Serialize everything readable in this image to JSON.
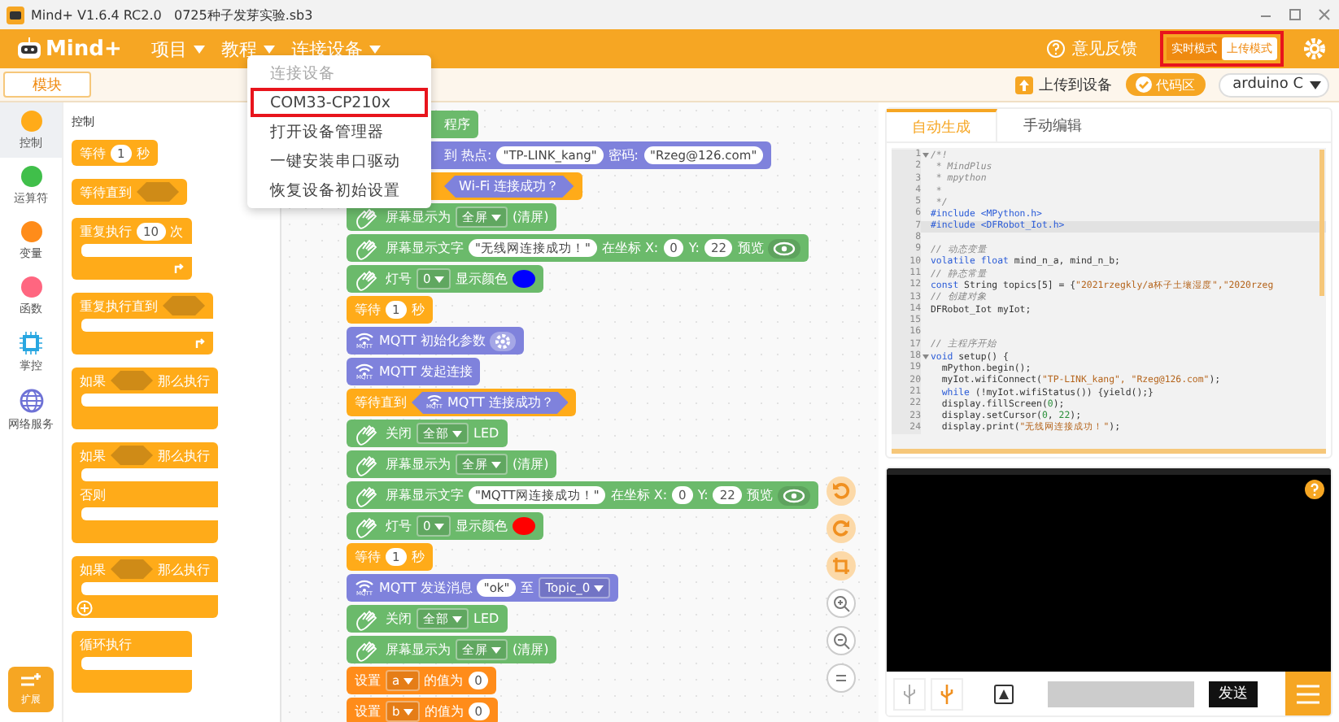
{
  "window": {
    "title": "Mind+ V1.6.4 RC2.0   0725种子发芽实验.sb3"
  },
  "menu_bar": {
    "logo": "Mind+",
    "menus": [
      {
        "label": "项目"
      },
      {
        "label": "教程"
      },
      {
        "label": "连接设备"
      }
    ],
    "feedback": "意见反馈",
    "modes": [
      {
        "label": "实时模式",
        "selected": false
      },
      {
        "label": "上传模式",
        "selected": true
      }
    ],
    "modes_highlighted": true
  },
  "connect_menu": {
    "items": [
      {
        "label": "连接设备",
        "disabled": true,
        "highlighted": false
      },
      {
        "label": "COM33-CP210x",
        "disabled": false,
        "highlighted": true
      },
      {
        "label": "打开设备管理器",
        "disabled": false,
        "highlighted": false
      },
      {
        "label": "一键安装串口驱动",
        "disabled": false,
        "highlighted": false
      },
      {
        "label": "恢复设备初始设置",
        "disabled": false,
        "highlighted": false
      }
    ]
  },
  "toolbar": {
    "blocks_tab": "模块",
    "upload": "上传到设备",
    "code_toggle": {
      "label": "代码区",
      "on": true
    },
    "device": "arduino C"
  },
  "categories": [
    {
      "label": "控制",
      "kind": "dot",
      "color": "#ffab19",
      "selected": true
    },
    {
      "label": "运算符",
      "kind": "dot",
      "color": "#40bf4a",
      "selected": false
    },
    {
      "label": "变量",
      "kind": "dot",
      "color": "#ff8c1a",
      "selected": false
    },
    {
      "label": "函数",
      "kind": "dot",
      "color": "#ff6680",
      "selected": false
    },
    {
      "label": "掌控",
      "kind": "chip",
      "color": "#29a7e1",
      "selected": false
    },
    {
      "label": "网络服务",
      "kind": "globe",
      "color": "#6e72d6",
      "selected": false
    }
  ],
  "extensions": "扩展",
  "palette": {
    "heading": "控制",
    "blocks": [
      {
        "kind": "stack",
        "parts": [
          {
            "kind": "text",
            "text": "等待"
          },
          {
            "kind": "number",
            "text": "1"
          },
          {
            "kind": "text",
            "text": "秒"
          }
        ]
      },
      {
        "kind": "stack",
        "parts": [
          {
            "kind": "text",
            "text": "等待直到"
          },
          {
            "kind": "hex"
          }
        ]
      },
      {
        "kind": "loop",
        "parts": [
          {
            "kind": "text",
            "text": "重复执行"
          },
          {
            "kind": "number",
            "text": "10"
          },
          {
            "kind": "text",
            "text": "次"
          }
        ]
      },
      {
        "kind": "loop",
        "parts": [
          {
            "kind": "text",
            "text": "重复执行直到"
          },
          {
            "kind": "hex"
          }
        ]
      },
      {
        "kind": "wrap",
        "parts": [
          {
            "kind": "text",
            "text": "如果"
          },
          {
            "kind": "hex"
          },
          {
            "kind": "text",
            "text": "那么执行"
          }
        ]
      },
      {
        "kind": "wrap",
        "middle": "否则",
        "parts": [
          {
            "kind": "text",
            "text": "如果"
          },
          {
            "kind": "hex"
          },
          {
            "kind": "text",
            "text": "那么执行"
          }
        ]
      },
      {
        "kind": "expandable",
        "parts": [
          {
            "kind": "text",
            "text": "如果"
          },
          {
            "kind": "hex"
          },
          {
            "kind": "text",
            "text": "那么执行"
          }
        ]
      },
      {
        "kind": "wrap",
        "parts": [
          {
            "kind": "text",
            "text": "循环执行"
          }
        ]
      }
    ]
  },
  "script": [
    {
      "kind": "display",
      "covered": true,
      "parts": [
        {
          "kind": "text",
          "text": "程序"
        }
      ]
    },
    {
      "kind": "mqtt",
      "covered": true,
      "parts": [
        {
          "kind": "text",
          "text": "到 热点:"
        },
        {
          "kind": "string",
          "text": "\"TP-LINK_kang\""
        },
        {
          "kind": "text",
          "text": "密码:"
        },
        {
          "kind": "string",
          "text": "\"Rzeg@126.com\""
        }
      ]
    },
    {
      "kind": "control",
      "covered": true,
      "parts": [
        {
          "kind": "bool",
          "text": "Wi-Fi 连接成功？"
        }
      ]
    },
    {
      "kind": "display",
      "covered": false,
      "parts": [
        {
          "kind": "text",
          "text": "屏幕显示为"
        },
        {
          "kind": "dropdown",
          "text": "全屏"
        },
        {
          "kind": "text",
          "text": "(清屏)"
        }
      ]
    },
    {
      "kind": "display",
      "covered": false,
      "parts": [
        {
          "kind": "text",
          "text": "屏幕显示文字"
        },
        {
          "kind": "string",
          "text": "\"无线网连接成功！\""
        },
        {
          "kind": "text",
          "text": "在坐标 X:"
        },
        {
          "kind": "number",
          "text": "0"
        },
        {
          "kind": "text",
          "text": "Y:"
        },
        {
          "kind": "number",
          "text": "22"
        },
        {
          "kind": "text",
          "text": "预览"
        },
        {
          "kind": "eye"
        }
      ]
    },
    {
      "kind": "display",
      "covered": false,
      "parts": [
        {
          "kind": "text",
          "text": "灯号"
        },
        {
          "kind": "dropdown",
          "text": "0"
        },
        {
          "kind": "text",
          "text": "显示颜色"
        },
        {
          "kind": "color",
          "color": "#0000ff"
        }
      ]
    },
    {
      "kind": "control",
      "covered": false,
      "parts": [
        {
          "kind": "text",
          "text": "等待"
        },
        {
          "kind": "number",
          "text": "1"
        },
        {
          "kind": "text",
          "text": "秒"
        }
      ]
    },
    {
      "kind": "mqtt",
      "covered": false,
      "icon_label": "MQTT",
      "parts": [
        {
          "kind": "text",
          "text": "MQTT 初始化参数"
        },
        {
          "kind": "gear"
        }
      ]
    },
    {
      "kind": "mqtt",
      "covered": false,
      "icon_label": "MQTT",
      "parts": [
        {
          "kind": "text",
          "text": "MQTT 发起连接"
        }
      ]
    },
    {
      "kind": "control",
      "covered": false,
      "parts": [
        {
          "kind": "text",
          "text": "等待直到"
        },
        {
          "kind": "bool",
          "icon_label": "MQTT",
          "text": "MQTT 连接成功？"
        }
      ]
    },
    {
      "kind": "display",
      "covered": false,
      "parts": [
        {
          "kind": "text",
          "text": "关闭"
        },
        {
          "kind": "dropdown",
          "text": "全部"
        },
        {
          "kind": "text",
          "text": "LED"
        }
      ]
    },
    {
      "kind": "display",
      "covered": false,
      "parts": [
        {
          "kind": "text",
          "text": "屏幕显示为"
        },
        {
          "kind": "dropdown",
          "text": "全屏"
        },
        {
          "kind": "text",
          "text": "(清屏)"
        }
      ]
    },
    {
      "kind": "display",
      "covered": false,
      "parts": [
        {
          "kind": "text",
          "text": "屏幕显示文字"
        },
        {
          "kind": "string",
          "text": "\"MQTT网连接成功！\""
        },
        {
          "kind": "text",
          "text": "在坐标 X:"
        },
        {
          "kind": "number",
          "text": "0"
        },
        {
          "kind": "text",
          "text": "Y:"
        },
        {
          "kind": "number",
          "text": "22"
        },
        {
          "kind": "text",
          "text": "预览"
        },
        {
          "kind": "eye"
        }
      ]
    },
    {
      "kind": "display",
      "covered": false,
      "parts": [
        {
          "kind": "text",
          "text": "灯号"
        },
        {
          "kind": "dropdown",
          "text": "0"
        },
        {
          "kind": "text",
          "text": "显示颜色"
        },
        {
          "kind": "color",
          "color": "#ff0000"
        }
      ]
    },
    {
      "kind": "control",
      "covered": false,
      "parts": [
        {
          "kind": "text",
          "text": "等待"
        },
        {
          "kind": "number",
          "text": "1"
        },
        {
          "kind": "text",
          "text": "秒"
        }
      ]
    },
    {
      "kind": "mqtt",
      "covered": false,
      "icon_label": "MQTT",
      "parts": [
        {
          "kind": "text",
          "text": "MQTT 发送消息"
        },
        {
          "kind": "string",
          "text": "\"ok\""
        },
        {
          "kind": "text",
          "text": "至"
        },
        {
          "kind": "dropdown",
          "text": "Topic_0"
        }
      ]
    },
    {
      "kind": "display",
      "covered": false,
      "parts": [
        {
          "kind": "text",
          "text": "关闭"
        },
        {
          "kind": "dropdown",
          "text": "全部"
        },
        {
          "kind": "text",
          "text": "LED"
        }
      ]
    },
    {
      "kind": "display",
      "covered": false,
      "parts": [
        {
          "kind": "text",
          "text": "屏幕显示为"
        },
        {
          "kind": "dropdown",
          "text": "全屏"
        },
        {
          "kind": "text",
          "text": "(清屏)"
        }
      ]
    },
    {
      "kind": "variable",
      "covered": false,
      "parts": [
        {
          "kind": "text",
          "text": "设置"
        },
        {
          "kind": "dropdown",
          "text": "a"
        },
        {
          "kind": "text",
          "text": "的值为"
        },
        {
          "kind": "number",
          "text": "0"
        }
      ]
    },
    {
      "kind": "variable",
      "covered": false,
      "parts": [
        {
          "kind": "text",
          "text": "设置"
        },
        {
          "kind": "dropdown",
          "text": "b"
        },
        {
          "kind": "text",
          "text": "的值为"
        },
        {
          "kind": "number",
          "text": "0"
        }
      ]
    }
  ],
  "code_tabs": [
    {
      "label": "自动生成",
      "selected": true
    },
    {
      "label": "手动编辑",
      "selected": false
    }
  ],
  "code_lines": [
    {
      "number": "1",
      "fold": true,
      "selected": false,
      "parts": [
        {
          "kind": "comment",
          "text": "/*!"
        }
      ]
    },
    {
      "number": "2",
      "fold": false,
      "selected": false,
      "parts": [
        {
          "kind": "comment",
          "text": " * MindPlus"
        }
      ]
    },
    {
      "number": "3",
      "fold": false,
      "selected": false,
      "parts": [
        {
          "kind": "comment",
          "text": " * mpython"
        }
      ]
    },
    {
      "number": "4",
      "fold": false,
      "selected": false,
      "parts": [
        {
          "kind": "comment",
          "text": " *"
        }
      ]
    },
    {
      "number": "5",
      "fold": false,
      "selected": false,
      "parts": [
        {
          "kind": "comment",
          "text": " */"
        }
      ]
    },
    {
      "number": "6",
      "fold": false,
      "selected": false,
      "parts": [
        {
          "kind": "keyword",
          "text": "#include <MPython.h>"
        }
      ]
    },
    {
      "number": "7",
      "fold": false,
      "selected": true,
      "parts": [
        {
          "kind": "keyword",
          "text": "#include <DFRobot_Iot.h>"
        }
      ]
    },
    {
      "number": "8",
      "fold": false,
      "selected": false
    },
    {
      "number": "9",
      "fold": false,
      "selected": false,
      "parts": [
        {
          "kind": "comment",
          "text": "// 动态变量"
        }
      ]
    },
    {
      "number": "10",
      "fold": false,
      "selected": false,
      "parts": [
        {
          "kind": "keyword",
          "text": "volatile float"
        },
        {
          "kind": "plain",
          "text": " mind_n_a, mind_n_b;"
        }
      ]
    },
    {
      "number": "11",
      "fold": false,
      "selected": false,
      "parts": [
        {
          "kind": "comment",
          "text": "// 静态常量"
        }
      ]
    },
    {
      "number": "12",
      "fold": false,
      "selected": false,
      "parts": [
        {
          "kind": "keyword",
          "text": "const"
        },
        {
          "kind": "plain",
          "text": " String topics[5] = {"
        },
        {
          "kind": "string",
          "text": "\"2021rzegkly/a杯子土壤湿度\",\"2020rzeg"
        }
      ]
    },
    {
      "number": "13",
      "fold": false,
      "selected": false,
      "parts": [
        {
          "kind": "comment",
          "text": "// 创建对象"
        }
      ]
    },
    {
      "number": "14",
      "fold": false,
      "selected": false,
      "parts": [
        {
          "kind": "plain",
          "text": "DFRobot_Iot myIot;"
        }
      ]
    },
    {
      "number": "15",
      "fold": false,
      "selected": false
    },
    {
      "number": "16",
      "fold": false,
      "selected": false
    },
    {
      "number": "17",
      "fold": false,
      "selected": false,
      "parts": [
        {
          "kind": "comment",
          "text": "// 主程序开始"
        }
      ]
    },
    {
      "number": "18",
      "fold": true,
      "selected": false,
      "parts": [
        {
          "kind": "keyword",
          "text": "void"
        },
        {
          "kind": "plain",
          "text": " setup() {"
        }
      ]
    },
    {
      "number": "19",
      "fold": false,
      "selected": false,
      "parts": [
        {
          "kind": "plain",
          "text": "  mPython.begin();"
        }
      ]
    },
    {
      "number": "20",
      "fold": false,
      "selected": false,
      "parts": [
        {
          "kind": "plain",
          "text": "  myIot.wifiConnect("
        },
        {
          "kind": "string",
          "text": "\"TP-LINK_kang\", \"Rzeg@126.com\""
        },
        {
          "kind": "plain",
          "text": ");"
        }
      ]
    },
    {
      "number": "21",
      "fold": false,
      "selected": false,
      "parts": [
        {
          "kind": "keyword",
          "text": "  while"
        },
        {
          "kind": "plain",
          "text": " (!myIot.wifiStatus()) {yield();}"
        }
      ]
    },
    {
      "number": "22",
      "fold": false,
      "selected": false,
      "parts": [
        {
          "kind": "plain",
          "text": "  display.fillScreen("
        },
        {
          "kind": "number",
          "text": "0"
        },
        {
          "kind": "plain",
          "text": ");"
        }
      ]
    },
    {
      "number": "23",
      "fold": false,
      "selected": false,
      "parts": [
        {
          "kind": "plain",
          "text": "  display.setCursor("
        },
        {
          "kind": "number",
          "text": "0"
        },
        {
          "kind": "plain",
          "text": ", "
        },
        {
          "kind": "number",
          "text": "22"
        },
        {
          "kind": "plain",
          "text": ");"
        }
      ]
    },
    {
      "number": "24",
      "fold": false,
      "selected": false,
      "parts": [
        {
          "kind": "plain",
          "text": "  display.print("
        },
        {
          "kind": "string",
          "text": "\"无线网连接成功！\""
        },
        {
          "kind": "plain",
          "text": ");"
        }
      ]
    }
  ],
  "serial": {
    "send": "发送"
  }
}
